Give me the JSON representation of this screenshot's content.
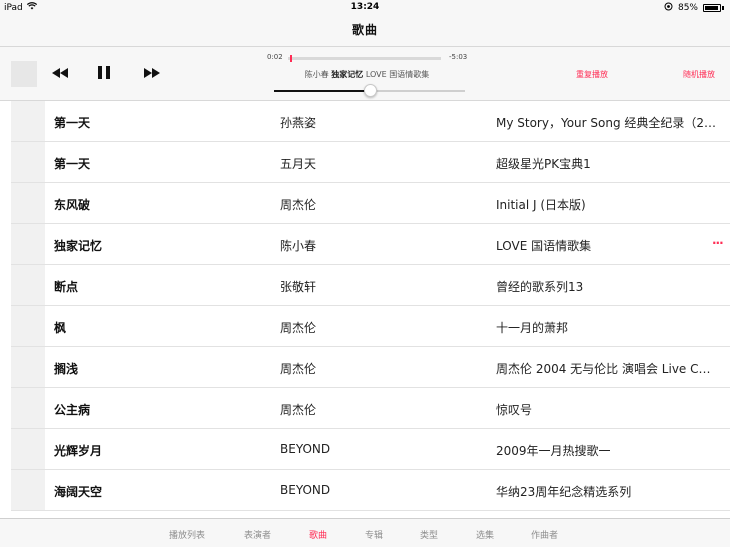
{
  "status_bar": {
    "device": "iPad",
    "time": "13:24",
    "battery": "85%"
  },
  "header": {
    "title": "歌曲"
  },
  "player": {
    "elapsed": "0:02",
    "remaining": "-5:03",
    "progress": 0.01,
    "artist": "陈小春",
    "song": "独家记忆",
    "album": "LOVE 国语情歌集",
    "volume": 0.5,
    "repeat_label": "重复播放",
    "shuffle_label": "随机播放"
  },
  "songs": [
    {
      "title": "第一天",
      "artist": "孙燕姿",
      "album": "My Story，Your Song 经典全纪录（2…"
    },
    {
      "title": "第一天",
      "artist": "五月天",
      "album": "超级星光PK宝典1"
    },
    {
      "title": "东风破",
      "artist": "周杰伦",
      "album": "Initial J (日本版)"
    },
    {
      "title": "独家记忆",
      "artist": "陈小春",
      "album": "LOVE 国语情歌集",
      "more": "..."
    },
    {
      "title": "断点",
      "artist": "张敬轩",
      "album": "曾经的歌系列13"
    },
    {
      "title": "枫",
      "artist": "周杰伦",
      "album": "十一月的萧邦"
    },
    {
      "title": "搁浅",
      "artist": "周杰伦",
      "album": "周杰伦 2004 无与伦比 演唱会 Live C…"
    },
    {
      "title": "公主病",
      "artist": "周杰伦",
      "album": "惊叹号"
    },
    {
      "title": "光辉岁月",
      "artist": "BEYOND",
      "album": "2009年一月热搜歌一"
    },
    {
      "title": "海阔天空",
      "artist": "BEYOND",
      "album": "华纳23周年纪念精选系列"
    }
  ],
  "tabs": [
    "播放列表",
    "表演者",
    "歌曲",
    "专辑",
    "类型",
    "选集",
    "作曲者"
  ],
  "active_tab": 2,
  "colors": {
    "accent": "#ff2d55"
  }
}
